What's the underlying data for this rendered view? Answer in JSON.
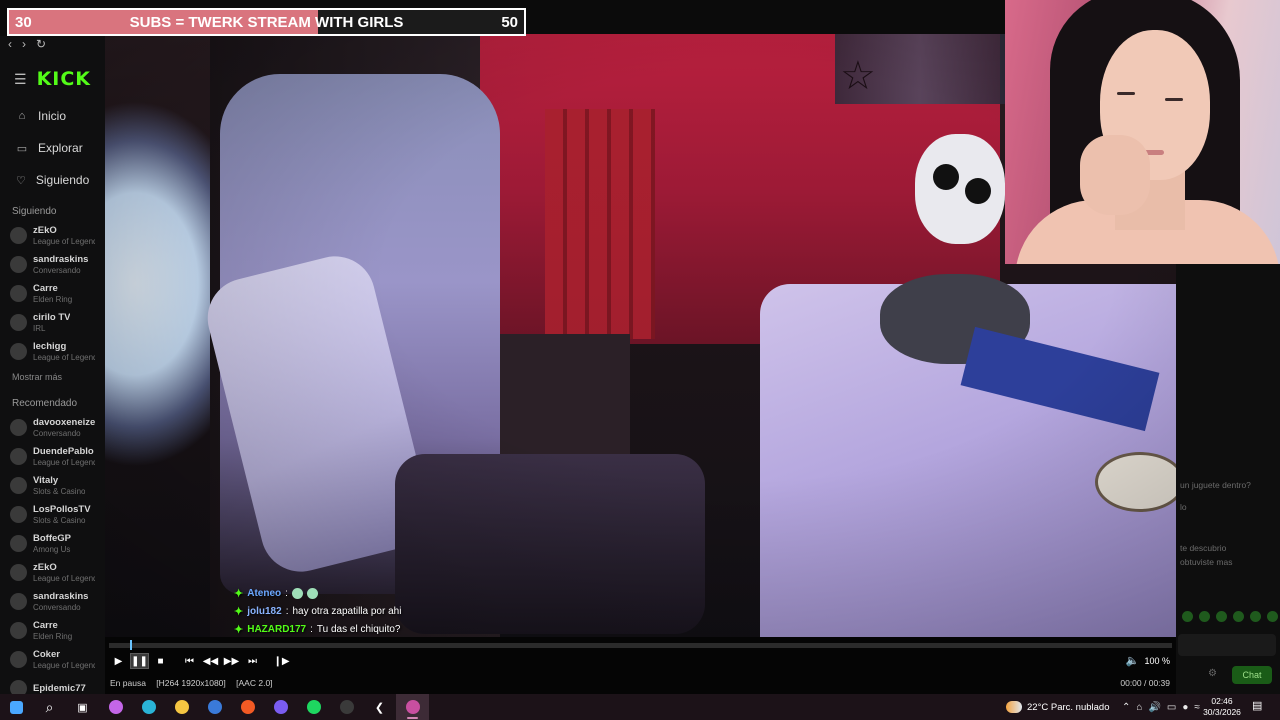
{
  "goal": {
    "current": "30",
    "title": "SUBS = TWERK STREAM WITH GIRLS",
    "target": "50",
    "progress_fraction": 0.6,
    "fill_color": "#d9747e"
  },
  "kick": {
    "logo": "KICK",
    "nav": [
      {
        "icon": "home-icon",
        "label": "Inicio"
      },
      {
        "icon": "compass-icon",
        "label": "Explorar"
      },
      {
        "icon": "heart-icon",
        "label": "Siguiendo"
      }
    ],
    "following_title": "Siguiendo",
    "following": [
      {
        "name": "zEkO",
        "sub": "League of Legends"
      },
      {
        "name": "sandraskins",
        "sub": "Conversando"
      },
      {
        "name": "Carre",
        "sub": "Elden Ring"
      },
      {
        "name": "cirilo TV",
        "sub": "IRL"
      },
      {
        "name": "lechigg",
        "sub": "League of Legends"
      }
    ],
    "show_more": "Mostrar más",
    "recommended_title": "Recomendado",
    "recommended": [
      {
        "name": "davooxeneize",
        "sub": "Conversando"
      },
      {
        "name": "DuendePablo",
        "sub": "League of Legends"
      },
      {
        "name": "Vitaly",
        "sub": "Slots & Casino"
      },
      {
        "name": "LosPollosTV",
        "sub": "Slots & Casino"
      },
      {
        "name": "BoffeGP",
        "sub": "Among Us"
      },
      {
        "name": "zEkO",
        "sub": "League of Legends"
      },
      {
        "name": "sandraskins",
        "sub": "Conversando"
      },
      {
        "name": "Carre",
        "sub": "Elden Ring"
      },
      {
        "name": "Coker",
        "sub": "League of Legends"
      },
      {
        "name": "Epidemic77",
        "sub": ""
      }
    ]
  },
  "chat_bg": {
    "lines": [
      "un juguete dentro?",
      "lo",
      "te descubrio",
      "obtuviste mas"
    ],
    "chat_button": "Chat"
  },
  "overlay_chat": [
    {
      "user": "Ateneo",
      "message": "",
      "user_color": "#6aa8ff"
    },
    {
      "user": "jolu182",
      "message": "hay otra zapatilla por ahi",
      "user_color": "#8ab4ff"
    },
    {
      "user": "HAZARD177",
      "message": "Tu das el chiquito?",
      "user_color": "#53fc18"
    }
  ],
  "player": {
    "progress_fraction": 0.02,
    "buttons": [
      "play-icon",
      "pause-icon",
      "stop-icon",
      "skip-back-icon",
      "rewind-icon",
      "forward-icon",
      "skip-forward-icon",
      "frame-step-icon"
    ],
    "volume": "100 %",
    "status": "En pausa",
    "video_codec": "[H264 1920x1080]",
    "audio_codec": "[AAC 2.0]",
    "time": "00:00 / 00:39"
  },
  "taskbar": {
    "apps": [
      {
        "name": "start-icon",
        "color": "#4aa8ff"
      },
      {
        "name": "search-icon",
        "color": "#ffffff"
      },
      {
        "name": "task-view-icon",
        "color": "#ffffff"
      },
      {
        "name": "copilot-icon",
        "color": "#c466e8"
      },
      {
        "name": "edge-icon",
        "color": "#2ab3d6"
      },
      {
        "name": "file-explorer-icon",
        "color": "#f4c542"
      },
      {
        "name": "mail-icon",
        "color": "#3a7ad9"
      },
      {
        "name": "brave-icon",
        "color": "#f25a24"
      },
      {
        "name": "discord-icon",
        "color": "#7a5cf0"
      },
      {
        "name": "spotify-icon",
        "color": "#1ed760"
      },
      {
        "name": "obs-icon",
        "color": "#3a3a3a"
      },
      {
        "name": "back-app-icon",
        "color": "#ffffff"
      },
      {
        "name": "media-player-icon",
        "color": "#c84fa0"
      }
    ],
    "weather": "22°C  Parc. nublado",
    "time": "02:46",
    "date": "30/3/2026"
  }
}
